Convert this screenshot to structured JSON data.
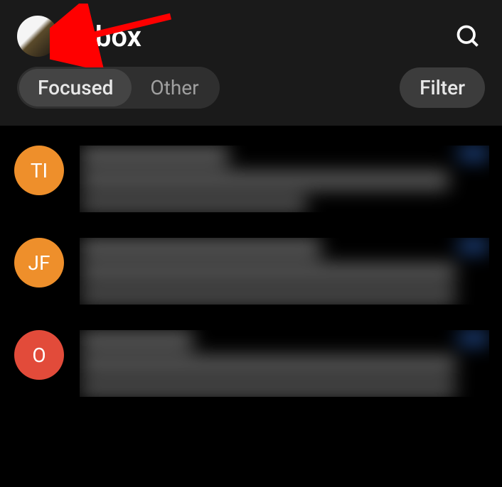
{
  "header": {
    "title": "Inbox",
    "avatar_label": "profile"
  },
  "tabs": {
    "focused": "Focused",
    "other": "Other"
  },
  "filter_label": "Filter",
  "emails": [
    {
      "initials": "TI",
      "avatar_color": "#ee8f2b"
    },
    {
      "initials": "JF",
      "avatar_color": "#ee8f2b"
    },
    {
      "initials": "O",
      "avatar_color": "#e24b3a"
    }
  ],
  "annotation": {
    "arrow_points_to": "profile-avatar",
    "arrow_color": "#ff0000"
  }
}
